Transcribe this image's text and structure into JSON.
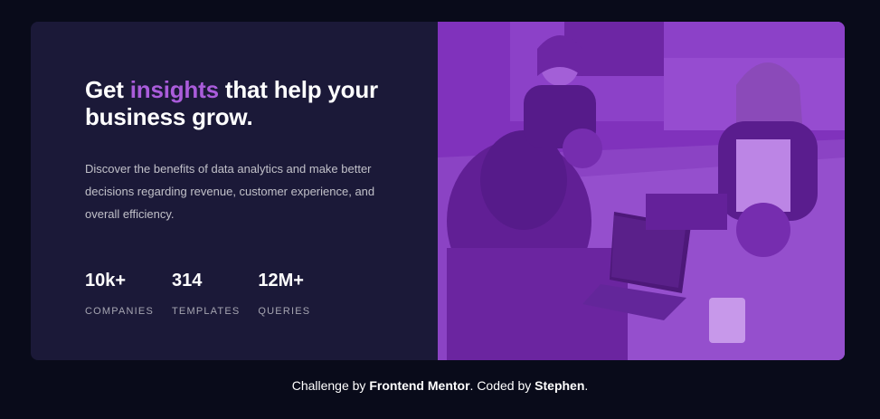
{
  "headline": {
    "before": "Get ",
    "accent": "insights",
    "after": " that help your business grow."
  },
  "description": "Discover the benefits of data analytics and make better decisions regarding revenue, customer experience, and overall efficiency.",
  "stats": [
    {
      "value": "10k+",
      "label": "COMPANIES"
    },
    {
      "value": "314",
      "label": "TEMPLATES"
    },
    {
      "value": "12M+",
      "label": "QUERIES"
    }
  ],
  "image_overlay_color": "#aa5cdb",
  "attribution": {
    "prefix": "Challenge by ",
    "brand": "Frontend Mentor",
    "middle": ". Coded by ",
    "author": "Stephen",
    "suffix": "."
  },
  "colors": {
    "page_bg": "#090b1a",
    "card_bg": "#1b1938",
    "accent": "#aa5cdb",
    "text": "#ffffff"
  }
}
